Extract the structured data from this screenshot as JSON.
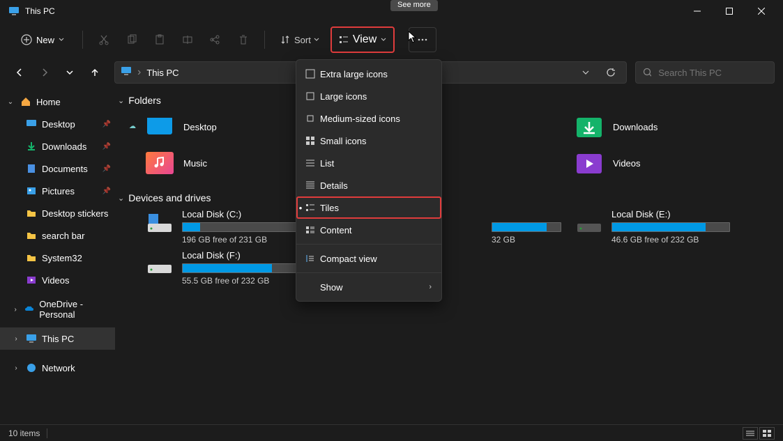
{
  "window": {
    "title": "This PC"
  },
  "tooltip": {
    "see_more": "See more"
  },
  "toolbar": {
    "new_label": "New",
    "sort_label": "Sort",
    "view_label": "View"
  },
  "address": {
    "crumb": "This PC"
  },
  "search": {
    "placeholder": "Search This PC"
  },
  "sidebar": {
    "home": "Home",
    "desktop": "Desktop",
    "downloads": "Downloads",
    "documents": "Documents",
    "pictures": "Pictures",
    "desktop_stickers": "Desktop stickers",
    "search_bar": "search bar",
    "system32": "System32",
    "videos": "Videos",
    "onedrive": "OneDrive - Personal",
    "this_pc": "This PC",
    "network": "Network"
  },
  "groups": {
    "folders": "Folders",
    "drives": "Devices and drives"
  },
  "folders": {
    "desktop": "Desktop",
    "downloads": "Downloads",
    "music": "Music",
    "videos": "Videos"
  },
  "drives": {
    "c": {
      "label": "Local Disk (C:)",
      "free": "196 GB free of 231 GB",
      "pct": 15
    },
    "e": {
      "label": "Local Disk (E:)",
      "free": "46.6 GB free of 232 GB",
      "pct": 80
    },
    "f": {
      "label": "Local Disk (F:)",
      "free": "55.5 GB free of 232 GB",
      "pct": 76
    },
    "d_free": "32 GB"
  },
  "view_menu": {
    "xl": "Extra large icons",
    "lg": "Large icons",
    "md": "Medium-sized icons",
    "sm": "Small icons",
    "list": "List",
    "details": "Details",
    "tiles": "Tiles",
    "content": "Content",
    "compact": "Compact view",
    "show": "Show"
  },
  "statusbar": {
    "count": "10 items"
  }
}
